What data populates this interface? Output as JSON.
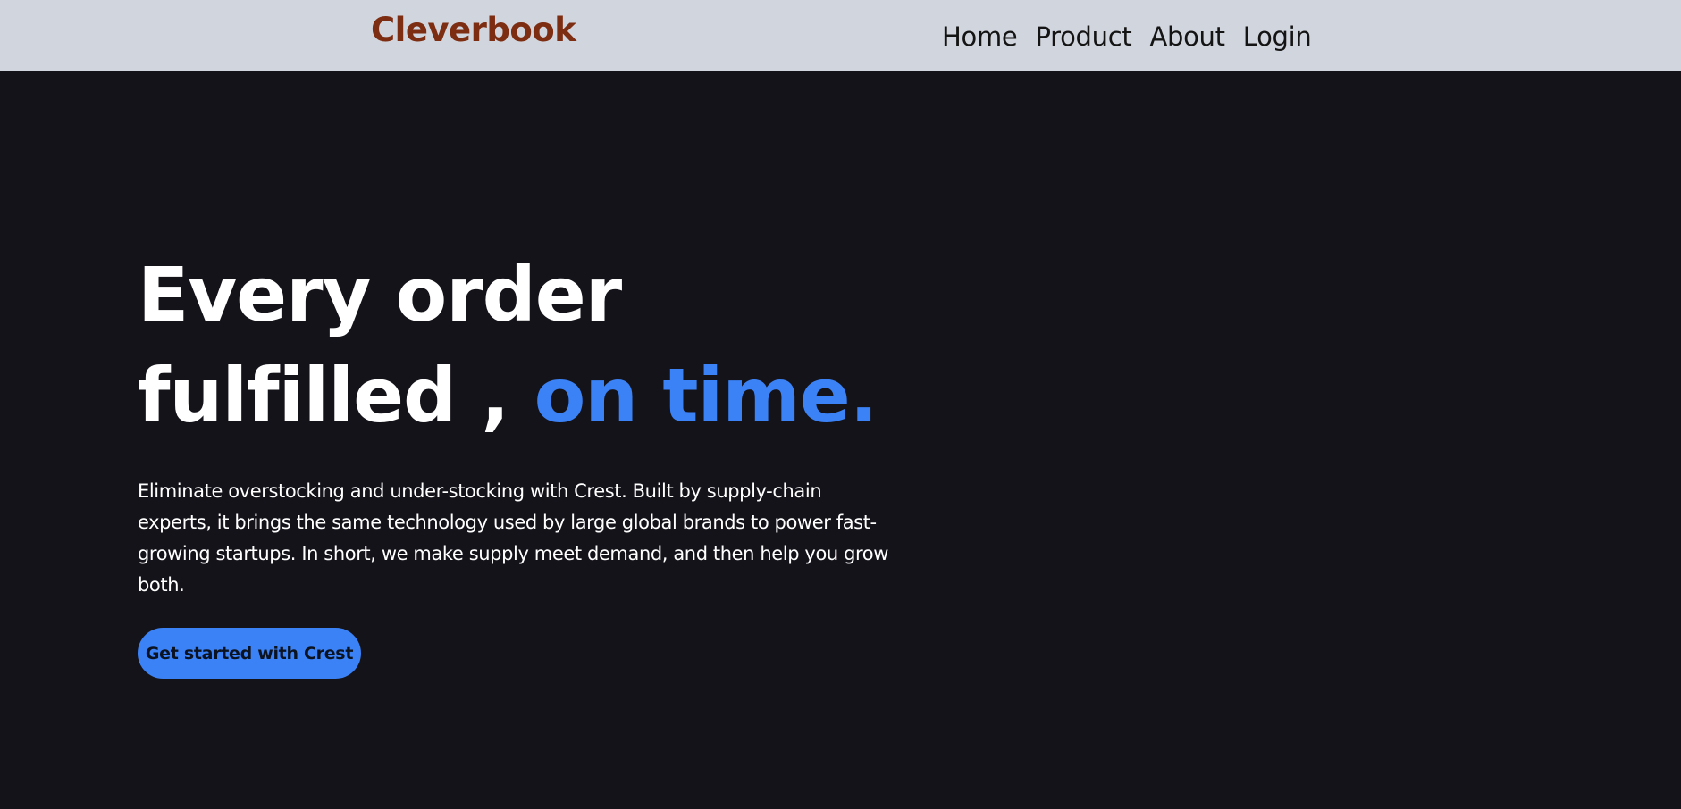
{
  "navbar": {
    "brand": "Cleverbook",
    "brand_color": "#7c2d12",
    "background_color": "#d1d5dd",
    "links": [
      {
        "label": "Home"
      },
      {
        "label": "Product"
      },
      {
        "label": "About"
      },
      {
        "label": "Login"
      }
    ]
  },
  "hero": {
    "background_color": "#15131a",
    "headline_line1": "Every order",
    "headline_line2": "fulfilled , ",
    "headline_accent": "on time.",
    "accent_color": "#3b82f6",
    "description": "Eliminate overstocking and under-stocking with Crest. Built by supply-chain experts, it brings the same technology used by large global brands to power fast-growing startups. In short, we make supply meet demand, and then help you grow both.",
    "cta_label": "Get started with Crest"
  }
}
